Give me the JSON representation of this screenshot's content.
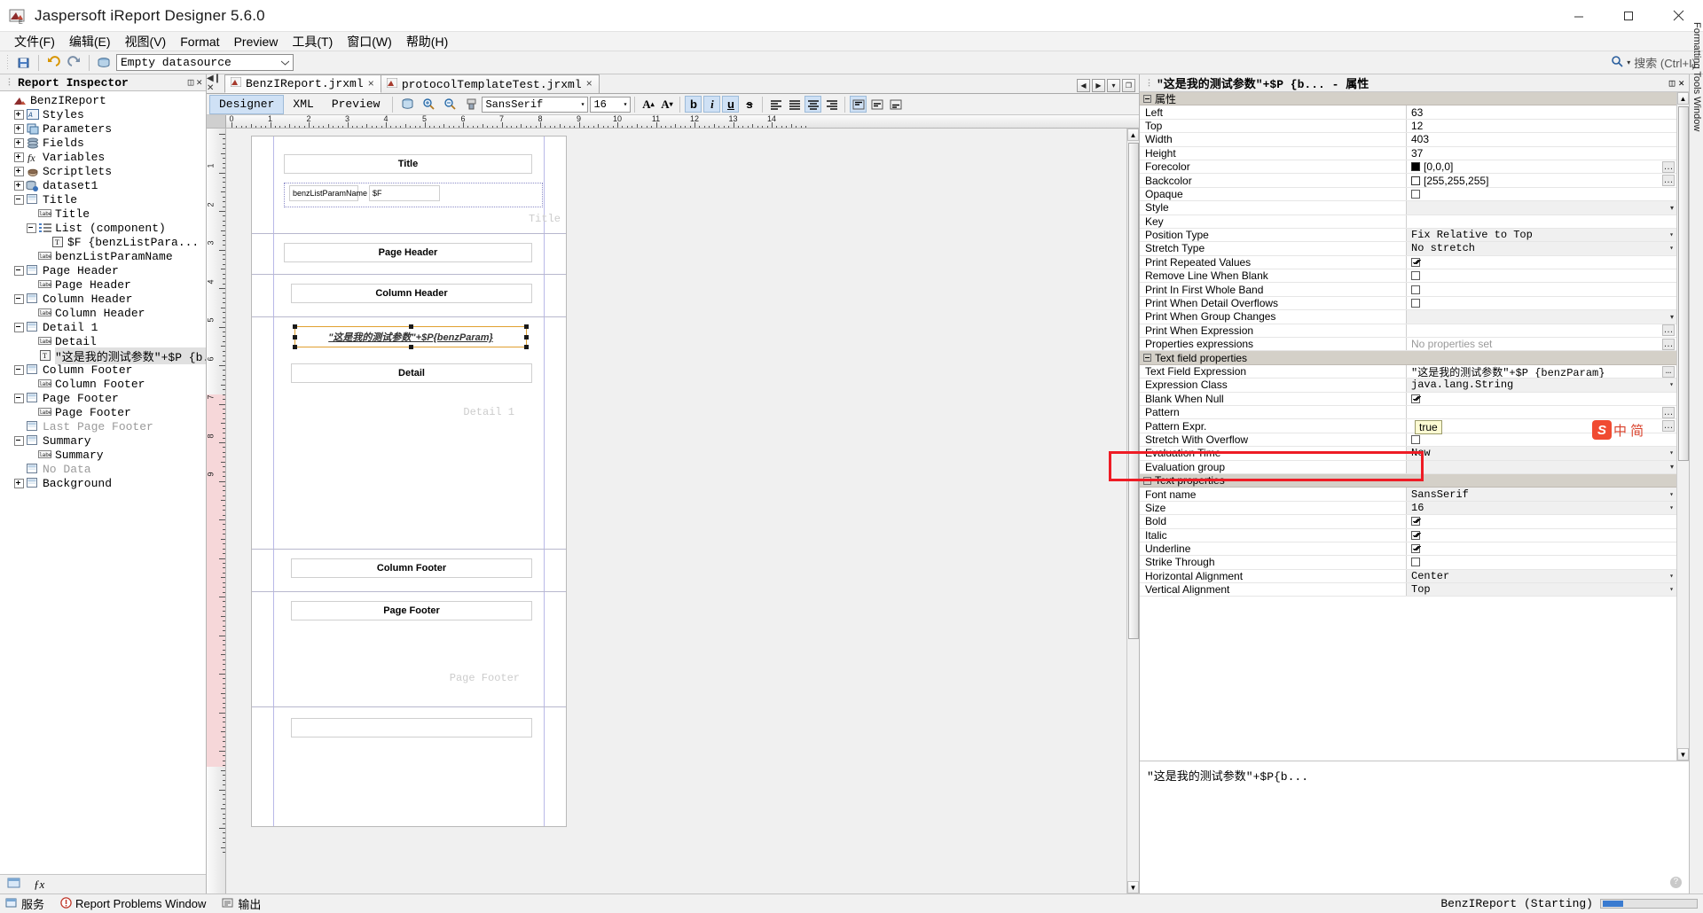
{
  "window": {
    "title": "Jaspersoft iReport Designer 5.6.0",
    "app_icon": "jasper-icon",
    "minimize": "minimize-icon",
    "maximize": "maximize-icon",
    "close": "close-icon"
  },
  "menu": [
    {
      "label": "文件(F)",
      "mn": "F"
    },
    {
      "label": "编辑(E)",
      "mn": "E"
    },
    {
      "label": "视图(V)",
      "mn": "V"
    },
    {
      "label": "Format",
      "mn": ""
    },
    {
      "label": "Preview",
      "mn": ""
    },
    {
      "label": "工具(T)",
      "mn": "T"
    },
    {
      "label": "窗口(W)",
      "mn": "W"
    },
    {
      "label": "帮助(H)",
      "mn": "H"
    }
  ],
  "toolbar": {
    "datasource_value": "Empty  datasource",
    "search_label": "搜索 (Ctrl+I)",
    "icons": [
      "save-all-icon",
      "undo-icon",
      "redo-icon",
      "datasource-icon"
    ]
  },
  "inspector": {
    "title": "Report Inspector",
    "nodes": [
      {
        "label": "BenzIReport",
        "depth": 0,
        "icon": "report-icon",
        "twist": "none"
      },
      {
        "label": "Styles",
        "depth": 1,
        "icon": "styles-icon",
        "twist": "plus"
      },
      {
        "label": "Parameters",
        "depth": 1,
        "icon": "parameters-icon",
        "twist": "plus"
      },
      {
        "label": "Fields",
        "depth": 1,
        "icon": "fields-icon",
        "twist": "plus"
      },
      {
        "label": "Variables",
        "depth": 1,
        "icon": "variables-icon",
        "twist": "plus"
      },
      {
        "label": "Scriptlets",
        "depth": 1,
        "icon": "scriptlets-icon",
        "twist": "plus"
      },
      {
        "label": "dataset1",
        "depth": 1,
        "icon": "dataset-icon",
        "twist": "plus"
      },
      {
        "label": "Title",
        "depth": 1,
        "icon": "band-icon",
        "twist": "minus"
      },
      {
        "label": "Title",
        "depth": 2,
        "icon": "label-icon",
        "twist": "none"
      },
      {
        "label": "List (component)",
        "depth": 2,
        "icon": "list-icon",
        "twist": "minus"
      },
      {
        "label": "$F {benzListPara...",
        "depth": 3,
        "icon": "textfield-icon",
        "twist": "none"
      },
      {
        "label": "benzListParamName",
        "depth": 2,
        "icon": "label-icon",
        "twist": "none"
      },
      {
        "label": "Page Header",
        "depth": 1,
        "icon": "band-icon",
        "twist": "minus"
      },
      {
        "label": "Page Header",
        "depth": 2,
        "icon": "label-icon",
        "twist": "none"
      },
      {
        "label": "Column Header",
        "depth": 1,
        "icon": "band-icon",
        "twist": "minus"
      },
      {
        "label": "Column Header",
        "depth": 2,
        "icon": "label-icon",
        "twist": "none"
      },
      {
        "label": "Detail 1",
        "depth": 1,
        "icon": "band-icon",
        "twist": "minus"
      },
      {
        "label": "Detail",
        "depth": 2,
        "icon": "label-icon",
        "twist": "none"
      },
      {
        "label": "\"这是我的测试参数\"+$P {b...",
        "depth": 2,
        "icon": "textfield-icon",
        "twist": "none",
        "selected": true
      },
      {
        "label": "Column Footer",
        "depth": 1,
        "icon": "band-icon",
        "twist": "minus"
      },
      {
        "label": "Column Footer",
        "depth": 2,
        "icon": "label-icon",
        "twist": "none"
      },
      {
        "label": "Page Footer",
        "depth": 1,
        "icon": "band-icon",
        "twist": "minus"
      },
      {
        "label": "Page Footer",
        "depth": 2,
        "icon": "label-icon",
        "twist": "none"
      },
      {
        "label": "Last Page Footer",
        "depth": 1,
        "icon": "band-icon",
        "twist": "none",
        "dim": true
      },
      {
        "label": "Summary",
        "depth": 1,
        "icon": "band-icon",
        "twist": "minus"
      },
      {
        "label": "Summary",
        "depth": 2,
        "icon": "label-icon",
        "twist": "none"
      },
      {
        "label": "No Data",
        "depth": 1,
        "icon": "band-icon",
        "twist": "none",
        "dim": true
      },
      {
        "label": "Background",
        "depth": 1,
        "icon": "band-icon",
        "twist": "plus"
      }
    ],
    "footer_icons": [
      "report-inspector-icon",
      "fx-icon"
    ]
  },
  "editor": {
    "tabs": [
      {
        "label": "BenzIReport.jrxml",
        "active": true,
        "close": "×"
      },
      {
        "label": "protocolTemplateTest.jrxml",
        "active": false,
        "close": "×"
      }
    ],
    "view_tabs": [
      {
        "label": "Designer",
        "active": true
      },
      {
        "label": "XML",
        "active": false
      },
      {
        "label": "Preview",
        "active": false
      }
    ],
    "font_name": "SansSerif",
    "font_size": "16",
    "format_buttons": [
      {
        "name": "increase-font-icon",
        "glyph": "A",
        "on": false
      },
      {
        "name": "decrease-font-icon",
        "glyph": "A",
        "on": false
      },
      {
        "name": "bold-icon",
        "glyph": "b",
        "on": true
      },
      {
        "name": "italic-icon",
        "glyph": "i",
        "on": true
      },
      {
        "name": "underline-icon",
        "glyph": "u",
        "on": true
      },
      {
        "name": "strikethrough-icon",
        "glyph": "s",
        "on": false
      },
      {
        "name": "align-left-icon",
        "glyph": "≡",
        "on": false
      },
      {
        "name": "align-center-icon",
        "glyph": "≡",
        "on": false
      },
      {
        "name": "align-right-icon",
        "glyph": "≡",
        "on": true
      },
      {
        "name": "align-justify-icon",
        "glyph": "≡",
        "on": false
      },
      {
        "name": "valign-top-icon",
        "glyph": "▤",
        "on": true
      },
      {
        "name": "valign-middle-icon",
        "glyph": "▤",
        "on": false
      },
      {
        "name": "valign-bottom-icon",
        "glyph": "▤",
        "on": false
      }
    ],
    "ruler_h_labels": [
      "0",
      "1",
      "2",
      "3",
      "4",
      "5",
      "6",
      "7",
      "8",
      "9",
      "10",
      "11",
      "12",
      "13",
      "14"
    ],
    "ruler_v_labels": [
      "1",
      "2",
      "3",
      "4",
      "5",
      "6",
      "7",
      "8",
      "9"
    ],
    "bands": [
      {
        "name": "Title",
        "watermark": "Title"
      },
      {
        "name": "Page Header",
        "watermark": "Page Header"
      },
      {
        "name": "Column Header",
        "watermark": "Column Header"
      },
      {
        "name": "Detail 1",
        "watermark": "Detail 1"
      },
      {
        "name": "Column Footer",
        "watermark": "Column Footer"
      },
      {
        "name": "Page Footer",
        "watermark": "Page Footer"
      }
    ],
    "elements": {
      "title_label": "Title",
      "list_param_label": "benzListParamName",
      "list_field": "$F",
      "page_header_label": "Page Header",
      "column_header_label": "Column Header",
      "detail_selected": "\"这是我的测试参数\"+$P{benzParam}",
      "detail_label": "Detail",
      "column_footer_label": "Column Footer",
      "page_footer_label": "Page Footer"
    }
  },
  "properties": {
    "header": "\"这是我的测试参数\"+$P {b...  -  属性",
    "groups": [
      {
        "type": "group",
        "label": "属性"
      },
      {
        "type": "row",
        "name": "Left",
        "value": "63",
        "kind": "text"
      },
      {
        "type": "row",
        "name": "Top",
        "value": "12",
        "kind": "text"
      },
      {
        "type": "row",
        "name": "Width",
        "value": "403",
        "kind": "text"
      },
      {
        "type": "row",
        "name": "Height",
        "value": "37",
        "kind": "text"
      },
      {
        "type": "row",
        "name": "Forecolor",
        "value": "[0,0,0]",
        "kind": "color",
        "swatch": "#000000",
        "ellipsis": true
      },
      {
        "type": "row",
        "name": "Backcolor",
        "value": "[255,255,255]",
        "kind": "color",
        "swatch": "#ffffff",
        "ellipsis": true
      },
      {
        "type": "row",
        "name": "Opaque",
        "value": "",
        "kind": "checkbox",
        "checked": false
      },
      {
        "type": "row",
        "name": "Style",
        "value": "",
        "kind": "combo"
      },
      {
        "type": "row",
        "name": "Key",
        "value": "",
        "kind": "text"
      },
      {
        "type": "row",
        "name": "Position Type",
        "value": "Fix Relative to Top",
        "kind": "combo-mono"
      },
      {
        "type": "row",
        "name": "Stretch Type",
        "value": "No stretch",
        "kind": "combo-mono"
      },
      {
        "type": "row",
        "name": "Print Repeated Values",
        "value": "",
        "kind": "checkbox",
        "checked": true
      },
      {
        "type": "row",
        "name": "Remove Line When Blank",
        "value": "",
        "kind": "checkbox",
        "checked": false
      },
      {
        "type": "row",
        "name": "Print In First Whole Band",
        "value": "",
        "kind": "checkbox",
        "checked": false
      },
      {
        "type": "row",
        "name": "Print When Detail Overflows",
        "value": "",
        "kind": "checkbox",
        "checked": false
      },
      {
        "type": "row",
        "name": "Print When Group Changes",
        "value": "",
        "kind": "combo"
      },
      {
        "type": "row",
        "name": "Print When Expression",
        "value": "",
        "kind": "text",
        "ellipsis": true
      },
      {
        "type": "row",
        "name": "Properties expressions",
        "value": "No properties set",
        "kind": "muted",
        "ellipsis": true
      },
      {
        "type": "group",
        "label": "Text field properties"
      },
      {
        "type": "row",
        "name": "Text Field Expression",
        "value": "\"这是我的测试参数\"+$P {benzParam}",
        "kind": "mono",
        "ellipsis": true
      },
      {
        "type": "row",
        "name": "Expression Class",
        "value": "java.lang.String",
        "kind": "combo-mono"
      },
      {
        "type": "row",
        "name": "Blank When Null",
        "value": "",
        "kind": "checkbox",
        "checked": true,
        "highlight": true
      },
      {
        "type": "row",
        "name": "Pattern",
        "value": "",
        "kind": "text",
        "ellipsis": true
      },
      {
        "type": "row",
        "name": "Pattern Expr.",
        "value": "",
        "kind": "text",
        "ellipsis": true
      },
      {
        "type": "row",
        "name": "Stretch With Overflow",
        "value": "",
        "kind": "checkbox",
        "checked": false
      },
      {
        "type": "row",
        "name": "Evaluation Time",
        "value": "Now",
        "kind": "combo-mono"
      },
      {
        "type": "row",
        "name": "Evaluation group",
        "value": "",
        "kind": "combo"
      },
      {
        "type": "group",
        "label": "Text properties"
      },
      {
        "type": "row",
        "name": "Font name",
        "value": "SansSerif",
        "kind": "combo-mono"
      },
      {
        "type": "row",
        "name": "Size",
        "value": "16",
        "kind": "combo-mono"
      },
      {
        "type": "row",
        "name": "Bold",
        "value": "",
        "kind": "checkbox",
        "checked": true
      },
      {
        "type": "row",
        "name": "Italic",
        "value": "",
        "kind": "checkbox",
        "checked": true
      },
      {
        "type": "row",
        "name": "Underline",
        "value": "",
        "kind": "checkbox",
        "checked": true
      },
      {
        "type": "row",
        "name": "Strike Through",
        "value": "",
        "kind": "checkbox",
        "checked": false
      },
      {
        "type": "row",
        "name": "Horizontal Alignment",
        "value": "Center",
        "kind": "combo-mono"
      },
      {
        "type": "row",
        "name": "Vertical Alignment",
        "value": "Top",
        "kind": "combo-mono"
      }
    ],
    "tooltip": "true",
    "footer_expression": "\"这是我的测试参数\"+$P{b..."
  },
  "right_strip": {
    "label": "Formatting Tools Window"
  },
  "ime": {
    "logo": "S",
    "mode": "中 简"
  },
  "statusbar": {
    "items": [
      {
        "label": "服务",
        "icon": "services-icon"
      },
      {
        "label": "Report Problems Window",
        "icon": "problems-icon"
      },
      {
        "label": "输出",
        "icon": "output-icon"
      }
    ],
    "right_text": "BenzIReport (Starting)",
    "progress_percent": 22
  }
}
